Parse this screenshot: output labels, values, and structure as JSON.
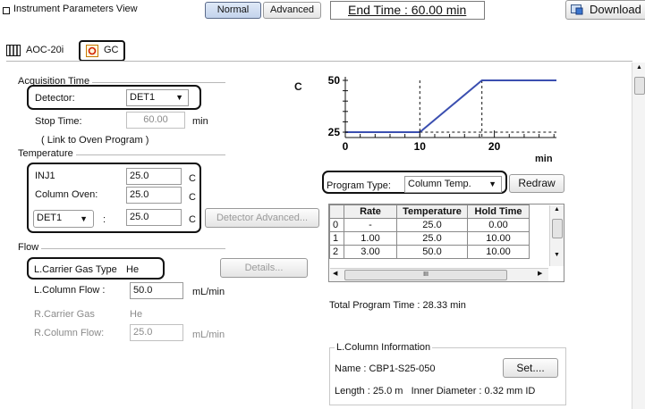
{
  "header": {
    "window_title": "Instrument Parameters View",
    "mode_normal": "Normal",
    "mode_advanced": "Advanced",
    "end_time": "End Time : 60.00 min",
    "download_label": "Download"
  },
  "tabs": [
    {
      "label": "AOC-20i"
    },
    {
      "label": "GC"
    }
  ],
  "acquisition": {
    "group_label": "Acquisition Time",
    "detector_label": "Detector:",
    "detector_value": "DET1",
    "stop_time_label": "Stop Time:",
    "stop_time_value": "60.00",
    "stop_time_unit": "min",
    "link_note": "( Link to Oven Program )"
  },
  "temperature": {
    "group_label": "Temperature",
    "inj_label": "INJ1",
    "inj_value": "25.0",
    "inj_unit": "C",
    "oven_label": "Column Oven:",
    "oven_value": "25.0",
    "oven_unit": "C",
    "det_select": "DET1",
    "det_colon": ":",
    "det_value": "25.0",
    "det_unit": "C",
    "detector_advanced": "Detector Advanced..."
  },
  "flow": {
    "group_label": "Flow",
    "carrier_label": "L.Carrier Gas Type",
    "carrier_value": "He",
    "details_button": "Details...",
    "column_flow_label": "L.Column Flow :",
    "column_flow_value": "50.0",
    "column_flow_unit": "mL/min",
    "r_carrier_label": "R.Carrier Gas",
    "r_carrier_value": "He",
    "r_column_flow_label": "R.Column Flow:",
    "r_column_flow_value": "25.0",
    "r_column_flow_unit": "mL/min"
  },
  "chart": {
    "unit_label": "C",
    "x_unit": "min"
  },
  "chart_data": {
    "type": "line",
    "x": [
      0,
      10,
      18.33,
      28.33
    ],
    "y": [
      25,
      25,
      50,
      50
    ],
    "xlim": [
      0,
      28.33
    ],
    "ylim": [
      25,
      50
    ],
    "x_ticks": [
      "0",
      "10",
      "20"
    ],
    "y_ticks": [
      "25",
      "50"
    ],
    "grid": "dashed at program steps",
    "line_color": "#3b4fb0"
  },
  "program": {
    "type_label": "Program Type:",
    "type_value": "Column Temp.",
    "redraw": "Redraw",
    "columns": [
      "",
      "Rate",
      "Temperature",
      "Hold Time"
    ],
    "rows": [
      [
        "0",
        "-",
        "25.0",
        "0.00"
      ],
      [
        "1",
        "1.00",
        "25.0",
        "10.00"
      ],
      [
        "2",
        "3.00",
        "50.0",
        "10.00"
      ]
    ],
    "hscroll_mark": "III",
    "total_time": "Total Program Time : 28.33 min"
  },
  "column_info": {
    "group_label": "L.Column Information",
    "name": "Name : CBP1-S25-050",
    "set_button": "Set....",
    "dims": "Length : 25.0 m   Inner Diameter : 0.32 mm ID"
  }
}
